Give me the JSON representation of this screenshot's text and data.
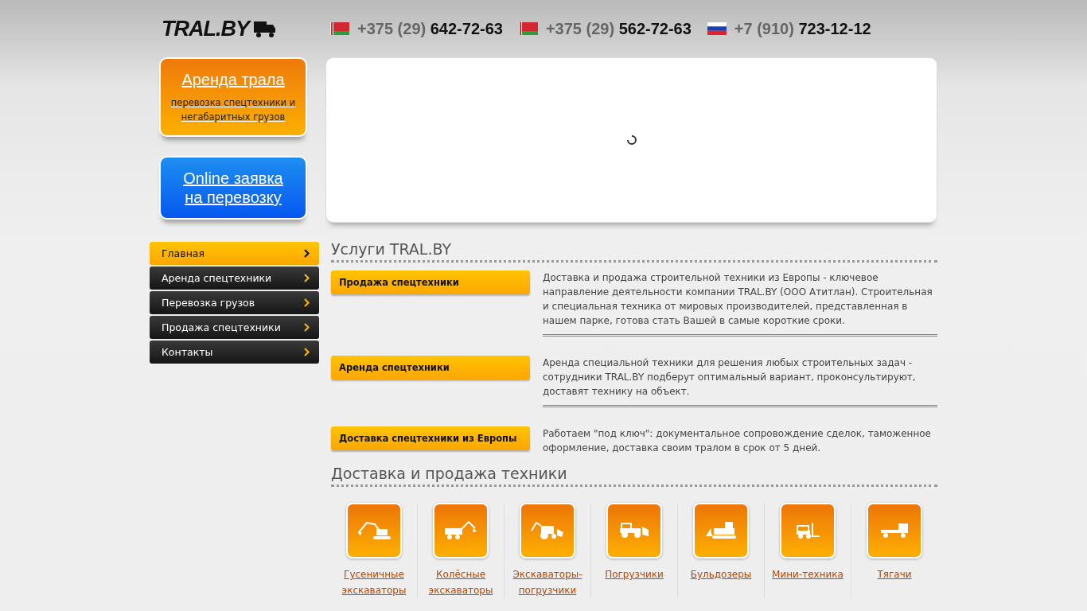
{
  "logo": {
    "text": "TRAL.BY"
  },
  "phones": [
    {
      "kind": "by",
      "prefix": "+375 (29)",
      "number": "642-72-63"
    },
    {
      "kind": "by",
      "prefix": "+375 (29)",
      "number": "562-72-63"
    },
    {
      "kind": "ru",
      "prefix": "+7 (910)",
      "number": "723-12-12"
    }
  ],
  "promos": [
    {
      "kind": "orange",
      "title": "Аренда трала",
      "subtitle": "перевозка спецтехники и негабаритных грузов"
    },
    {
      "kind": "blue",
      "title": "Online заявка на перевозку"
    }
  ],
  "menu": [
    {
      "label": "Главная",
      "selected": true
    },
    {
      "label": "Аренда спецтехники",
      "selected": false
    },
    {
      "label": "Перевозка грузов",
      "selected": false
    },
    {
      "label": "Продажа спецтехники",
      "selected": false
    },
    {
      "label": "Контакты",
      "selected": false
    }
  ],
  "services": {
    "title": "Услуги TRAL.BY",
    "items": [
      {
        "button": "Продажа спецтехники",
        "text": "Доставка и продажа строительной техники из Европы - ключевое направление деятельности компании TRAL.BY (ООО Атитлан). Строительная и специальная техника от мировых производителей, представленная в нашем парке, готова стать Вашей в самые короткие сроки."
      },
      {
        "button": "Аренда спецтехники",
        "text": "Аренда специальной техники для решения любых строительных задач - сотрудники TRAL.BY подберут оптимальный вариант, проконсультируют, доставят технику на объект."
      },
      {
        "button": "Доставка спецтехники из Европы",
        "text": "Работаем \"под ключ\": документальное сопровождение сделок, таможенное оформление, доставка своим тралом в срок от 5 дней."
      }
    ]
  },
  "catalog": {
    "title": "Доставка и продажа техники",
    "items": [
      {
        "kind": "excavator",
        "label": "Гусеничные экскаваторы"
      },
      {
        "kind": "wheeled",
        "label": "Колёсные экскаваторы"
      },
      {
        "kind": "backhoe",
        "label": "Экскаваторы-погрузчики"
      },
      {
        "kind": "loader",
        "label": "Погрузчики"
      },
      {
        "kind": "bulldozer",
        "label": "Бульдозеры"
      },
      {
        "kind": "forklift",
        "label": "Мини-техника"
      },
      {
        "kind": "truck",
        "label": "Тягачи"
      }
    ]
  }
}
